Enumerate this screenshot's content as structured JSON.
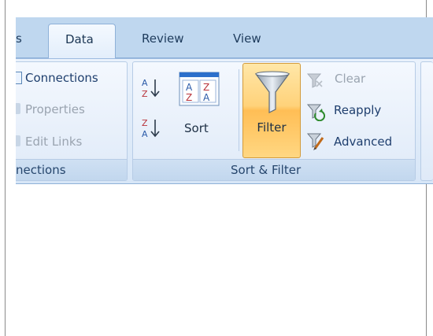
{
  "tabs": {
    "left_partial": "s",
    "active": "Data",
    "review": "Review",
    "view": "View"
  },
  "connections_group": {
    "connections": "Connections",
    "properties": "Properties",
    "edit_links": "Edit Links",
    "label": "nections"
  },
  "sort_filter_group": {
    "sort": "Sort",
    "filter": "Filter",
    "clear": "Clear",
    "reapply": "Reapply",
    "advanced": "Advanced",
    "label": "Sort & Filter"
  },
  "colors": {
    "ribbon_blue": "#d7e6f7",
    "tabstrip_blue": "#bfd7ef",
    "filter_highlight": "#ffbe55",
    "text_blue": "#1f3f6e",
    "disabled_gray": "#9aa4b0"
  },
  "icons": [
    "connections-icon",
    "properties-icon",
    "edit-links-icon",
    "sort-az-icon",
    "sort-za-icon",
    "sort-dialog-icon",
    "funnel-icon",
    "clear-filter-icon",
    "reapply-icon",
    "advanced-filter-icon"
  ]
}
